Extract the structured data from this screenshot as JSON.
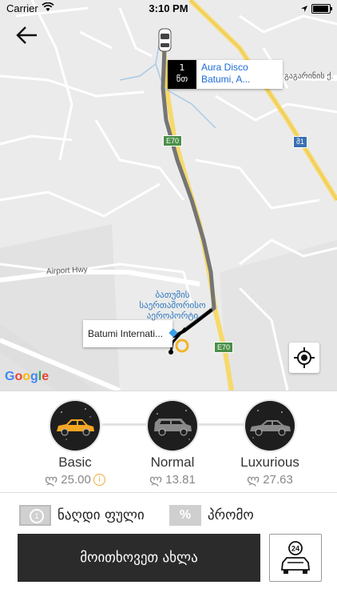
{
  "status_bar": {
    "carrier": "Carrier",
    "time": "3:10 PM"
  },
  "map": {
    "pickup": {
      "eta_number": "1",
      "eta_unit": "წთ",
      "place": "Aura Disco Batumi, A..."
    },
    "destination": {
      "place": "Batumi Internati..."
    },
    "airport_label": "ბათუმის საერთაშორისო აეროპორტი",
    "road_labels": {
      "airport_hwy": "Airport Hwy",
      "street_right": "გაგარინის ქ."
    },
    "road_shields": {
      "e70_top": "E70",
      "e70_bottom": "E70",
      "route_right": "მ1"
    },
    "google_logo": "Google",
    "route_color": "#757575"
  },
  "car_options": [
    {
      "name": "Basic",
      "price": "ლ 25.00",
      "info": "i",
      "color": "#f5a623"
    },
    {
      "name": "Normal",
      "price": "ლ 13.81",
      "color": "#8a8a8a"
    },
    {
      "name": "Luxurious",
      "price": "ლ 27.63",
      "color": "#8a8a8a"
    }
  ],
  "payment": {
    "cash_coin": "1",
    "cash_label": "ნაღდი ფული",
    "promo_symbol": "%",
    "promo_label": "პრომო"
  },
  "actions": {
    "order_label": "მოითხოვეთ ახლა",
    "schedule_badge": "24"
  }
}
